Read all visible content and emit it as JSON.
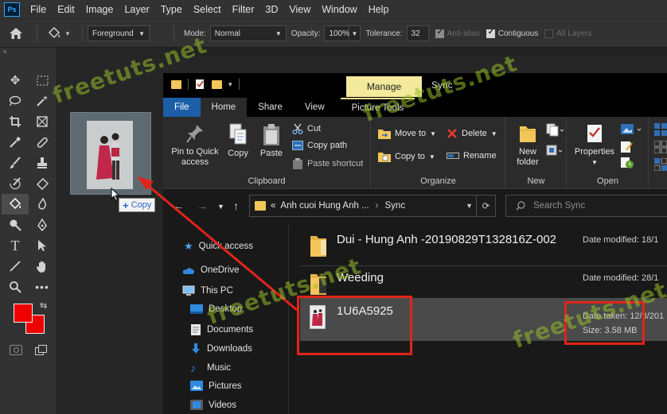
{
  "photoshop": {
    "logo": "Ps",
    "menu": [
      "File",
      "Edit",
      "Image",
      "Layer",
      "Type",
      "Select",
      "Filter",
      "3D",
      "View",
      "Window",
      "Help"
    ],
    "options": {
      "fill_source": "Foreground",
      "mode_label": "Mode:",
      "mode_value": "Normal",
      "opacity_label": "Opacity:",
      "opacity_value": "100%",
      "tolerance_label": "Tolerance:",
      "tolerance_value": "32",
      "anti_alias_label": "Anti-alias",
      "anti_alias_checked": true,
      "contiguous_label": "Contiguous",
      "contiguous_checked": true,
      "all_layers_label": "All Layers",
      "all_layers_checked": false
    },
    "colors": {
      "foreground": "#ee0000",
      "background": "#ee0000",
      "accent": "#31a8ff"
    }
  },
  "drag": {
    "tooltip": "Copy"
  },
  "explorer": {
    "contextual_tab": "Manage",
    "window_title": "Sync",
    "tabs": [
      "File",
      "Home",
      "Share",
      "View",
      "Picture Tools"
    ],
    "ribbon": {
      "clipboard": {
        "title": "Clipboard",
        "pin_label": "Pin to Quick access",
        "copy_label": "Copy",
        "paste_label": "Paste",
        "cut_label": "Cut",
        "copy_path_label": "Copy path",
        "paste_shortcut_label": "Paste shortcut"
      },
      "organize": {
        "title": "Organize",
        "move_to_label": "Move to",
        "copy_to_label": "Copy to",
        "delete_label": "Delete",
        "rename_label": "Rename"
      },
      "new": {
        "title": "New",
        "new_folder_label": "New folder"
      },
      "open": {
        "title": "Open",
        "properties_label": "Properties"
      }
    },
    "address": {
      "prefix": "«",
      "crumb_1": "Anh cuoi Hung Anh ...",
      "crumb_2": "Sync",
      "search_placeholder": "Search Sync"
    },
    "nav": {
      "quick_access": "Quick access",
      "onedrive": "OneDrive",
      "this_pc": "This PC",
      "desktop": "Desktop",
      "documents": "Documents",
      "downloads": "Downloads",
      "music": "Music",
      "pictures": "Pictures",
      "videos": "Videos"
    },
    "files": [
      {
        "name": "Dui - Hung  Anh -20190829T132816Z-002",
        "meta": "Date modified: 18/1"
      },
      {
        "name": "Weeding",
        "meta": "Date modified: 28/1"
      },
      {
        "name": "1U6A5925",
        "meta_1": "Date taken: 12/8/201",
        "meta_2": "Size: 3.58 MB"
      }
    ]
  },
  "watermark": "freetuts.net"
}
